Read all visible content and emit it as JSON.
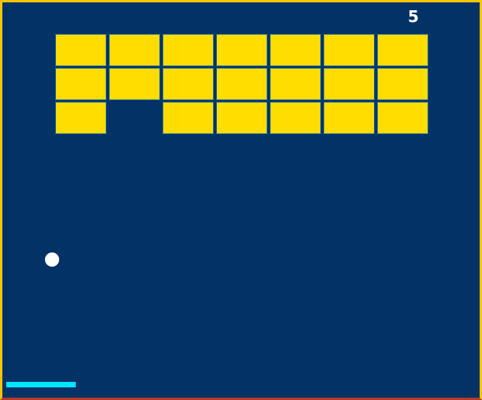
{
  "game": {
    "score": "5"
  },
  "colors": {
    "background": "#033266",
    "brick": "#ffdd00",
    "brick_border": "#1e6f96",
    "frame": "#f5c400",
    "ball": "#ffffff",
    "paddle": "#00e5ff",
    "score_text": "#ffffff"
  },
  "bricks": [
    [
      1,
      1,
      1,
      1,
      1,
      1,
      1
    ],
    [
      1,
      1,
      1,
      1,
      1,
      1,
      1
    ],
    [
      1,
      0,
      1,
      1,
      1,
      1,
      1
    ]
  ]
}
